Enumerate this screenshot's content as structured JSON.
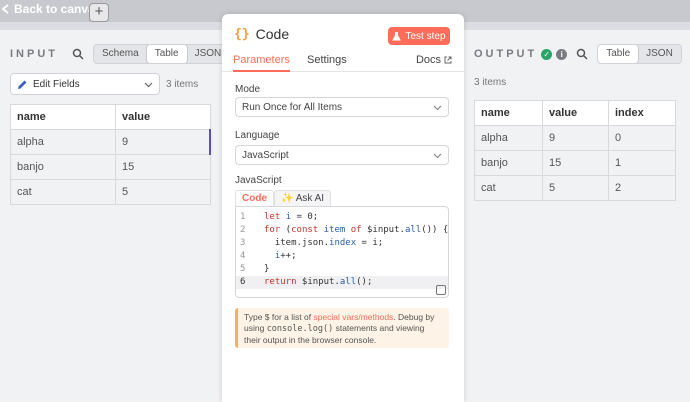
{
  "topbar": {
    "back_label": "Back to canvas",
    "add_label": "+"
  },
  "input": {
    "title": "INPUT",
    "tabs": [
      "Schema",
      "Table",
      "JSON"
    ],
    "active_tab": "Table",
    "source_node": "Edit Fields",
    "items_count": "3 items",
    "columns": [
      "name",
      "value"
    ],
    "rows": [
      [
        "alpha",
        "9"
      ],
      [
        "banjo",
        "15"
      ],
      [
        "cat",
        "5"
      ]
    ]
  },
  "modal": {
    "title": "Code",
    "test_button": "Test step",
    "tabs": [
      "Parameters",
      "Settings"
    ],
    "docs_label": "Docs",
    "mode_label": "Mode",
    "mode_value": "Run Once for All Items",
    "language_label": "Language",
    "language_value": "JavaScript",
    "code_section_label": "JavaScript",
    "code_tabs": [
      "Code",
      "Ask AI"
    ],
    "code_lines": [
      "let i = 0;",
      "for (const item of $input.all()) {",
      "  item.json.index = i;",
      "  i++;",
      "}",
      "return $input.all();"
    ],
    "hint_prefix": "Type $ for a list of ",
    "hint_link": "special vars/methods",
    "hint_mid": ". Debug by using ",
    "hint_code": "console.log()",
    "hint_suffix": " statements and viewing their output in the browser console."
  },
  "output": {
    "title": "OUTPUT",
    "tabs": [
      "Table",
      "JSON"
    ],
    "active_tab": "Table",
    "items_count": "3 items",
    "columns": [
      "name",
      "value",
      "index"
    ],
    "rows": [
      [
        "alpha",
        "9",
        "0"
      ],
      [
        "banjo",
        "15",
        "1"
      ],
      [
        "cat",
        "5",
        "2"
      ]
    ]
  },
  "colors": {
    "accent": "#ff6d5a",
    "success": "#29a568",
    "info": "#7a7b80"
  }
}
